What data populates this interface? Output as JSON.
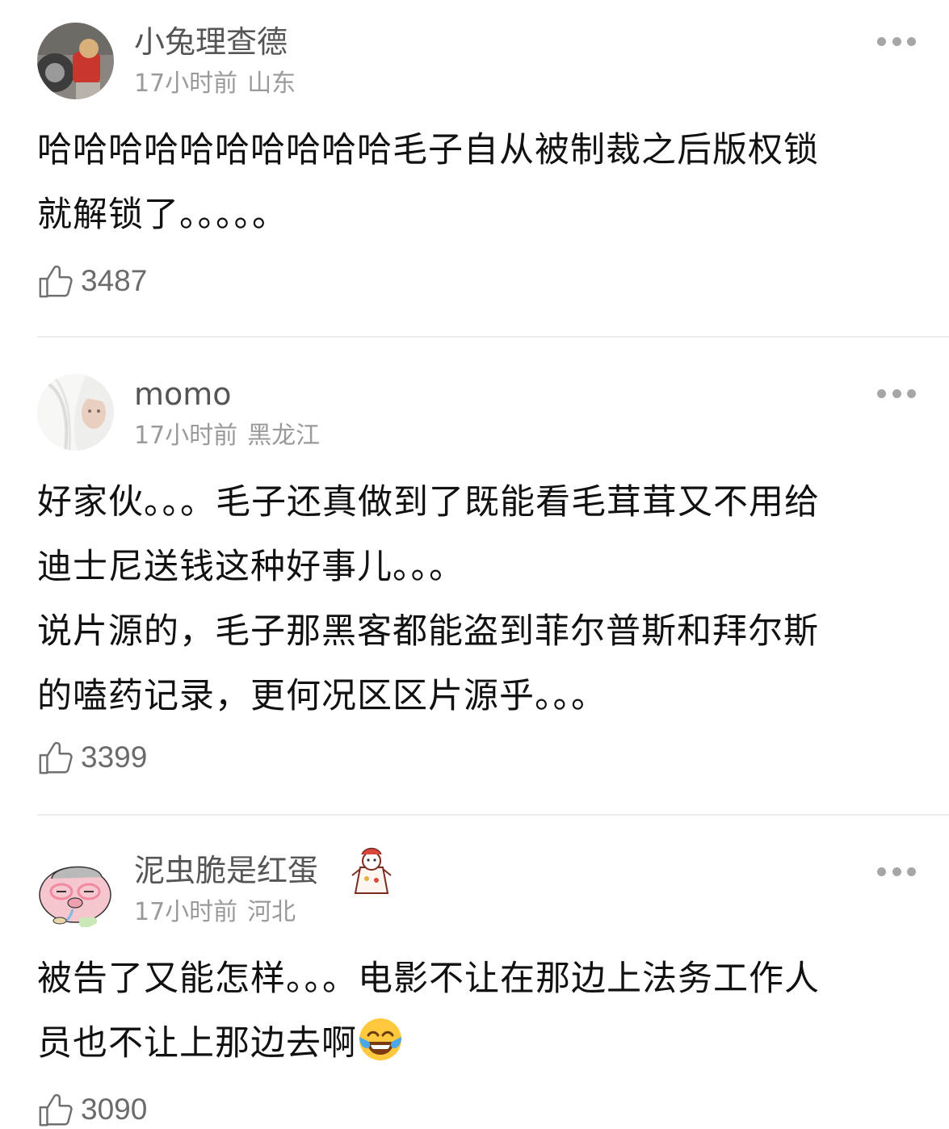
{
  "comments": [
    {
      "username": "小兔理查德",
      "time": "17小时前",
      "location": "山东",
      "lines": [
        "哈哈哈哈哈哈哈哈哈哈毛子自从被制裁之后版权锁",
        "就解锁了。。。。。"
      ],
      "likes": "3487"
    },
    {
      "username": "momo",
      "time": "17小时前",
      "location": "黑龙江",
      "lines": [
        "好家伙。。。毛子还真做到了既能看毛茸茸又不用给",
        "迪士尼送钱这种好事儿。。。",
        "说片源的，毛子那黑客都能盗到菲尔普斯和拜尔斯",
        "的嗑药记录，更何况区区片源乎。。。"
      ],
      "likes": "3399"
    },
    {
      "username": "泥虫脆是红蛋",
      "time": "17小时前",
      "location": "河北",
      "lines": [
        "被告了又能怎样。。。电影不让在那边上法务工作人",
        "员也不让上那边去啊"
      ],
      "likes": "3090"
    }
  ],
  "icons": {
    "more": "more-dots-icon",
    "like": "thumbs-up-icon",
    "emoji": "laugh-cry-emoji-icon"
  }
}
